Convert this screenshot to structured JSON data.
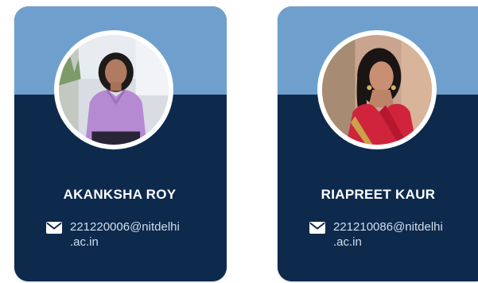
{
  "members": [
    {
      "name": "AKANKSHA ROY",
      "email_line1": "221220006@nitdelhi",
      "email_line2": ".ac.in",
      "photo_icon": "person-photo"
    },
    {
      "name": "RIAPREET KAUR",
      "email_line1": "221210086@nitdelhi",
      "email_line2": ".ac.in",
      "photo_icon": "person-photo"
    }
  ],
  "colors": {
    "card_top": "#6fa0cd",
    "card_bottom": "#0d2a4d",
    "name_text": "#ffffff",
    "email_text": "#d3deea"
  },
  "icons": {
    "email": "mail-icon"
  }
}
